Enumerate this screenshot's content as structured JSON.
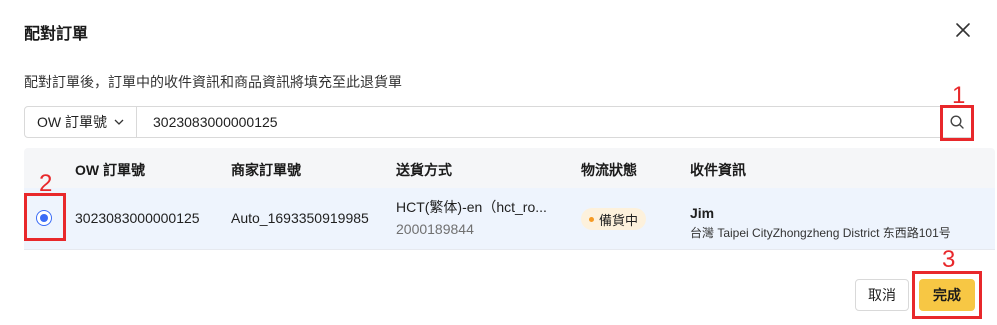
{
  "dialog": {
    "title": "配對訂單",
    "description": "配對訂單後，訂單中的收件資訊和商品資訊將填充至此退貨單"
  },
  "search": {
    "select_label": "OW 訂單號",
    "value": "3023083000000125"
  },
  "table": {
    "headers": [
      "OW 訂單號",
      "商家訂單號",
      "送貨方式",
      "物流狀態",
      "收件資訊"
    ],
    "row": {
      "ow_order": "3023083000000125",
      "merchant_order": "Auto_1693350919985",
      "shipping_method": "HCT(繁体)-en（hct_ro...",
      "tracking_number": "2000189844",
      "status": "備貨中",
      "recipient_name": "Jim",
      "recipient_address": "台灣 Taipei CityZhongzheng District 东西路101号",
      "selected": true
    }
  },
  "footer": {
    "cancel_label": "取消",
    "done_label": "完成"
  },
  "annotations": [
    "1",
    "2",
    "3"
  ],
  "colors": {
    "accent_blue": "#3b6cf6",
    "primary_yellow": "#f7c744",
    "annotation_red": "#e8282b",
    "status_dot": "#f59a23"
  }
}
